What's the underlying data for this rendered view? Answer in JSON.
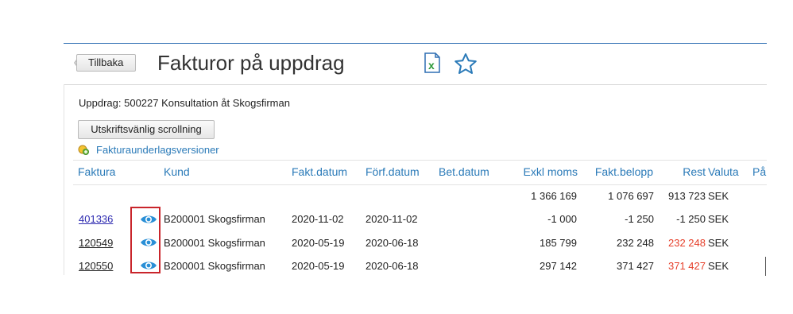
{
  "header": {
    "back_label": "Tillbaka",
    "title": "Fakturor på uppdrag"
  },
  "icons": {
    "excel": "excel-export-icon",
    "favorite": "star-icon",
    "versions": "document-versions-icon",
    "view": "eye-icon"
  },
  "info": {
    "uppdrag_label": "Uppdrag:",
    "uppdrag_value": "500227 Konsultation åt Skogsfirman"
  },
  "actions": {
    "print_label": "Utskriftsvänlig scrollning",
    "versions_link": "Fakturaunderlagsversioner"
  },
  "table": {
    "columns": {
      "faktura": "Faktura",
      "kund": "Kund",
      "fakt_datum": "Fakt.datum",
      "forf_datum": "Förf.datum",
      "bet_datum": "Bet.datum",
      "exkl_moms": "Exkl moms",
      "fakt_belopp": "Fakt.belopp",
      "rest": "Rest",
      "valuta": "Valuta",
      "pa": "På"
    },
    "totals": {
      "exkl_moms": "1 366 169",
      "fakt_belopp": "1 076 697",
      "rest": "913 723",
      "valuta": "SEK"
    },
    "rows": [
      {
        "faktura": "401336",
        "kund": "B200001 Skogsfirman",
        "fakt_datum": "2020-11-02",
        "forf_datum": "2020-11-02",
        "bet_datum": "",
        "exkl_moms": "-1 000",
        "fakt_belopp": "-1 250",
        "rest": "-1 250",
        "valuta": "SEK"
      },
      {
        "faktura": "120549",
        "kund": "B200001 Skogsfirman",
        "fakt_datum": "2020-05-19",
        "forf_datum": "2020-06-18",
        "bet_datum": "",
        "exkl_moms": "185 799",
        "fakt_belopp": "232 248",
        "rest": "232 248",
        "valuta": "SEK"
      },
      {
        "faktura": "120550",
        "kund": "B200001 Skogsfirman",
        "fakt_datum": "2020-05-19",
        "forf_datum": "2020-06-18",
        "bet_datum": "",
        "exkl_moms": "297 142",
        "fakt_belopp": "371 427",
        "rest": "371 427",
        "valuta": "SEK"
      }
    ]
  },
  "colors": {
    "link": "#2a7ab8",
    "overdue": "#e6402b",
    "highlight": "#c9252b"
  }
}
